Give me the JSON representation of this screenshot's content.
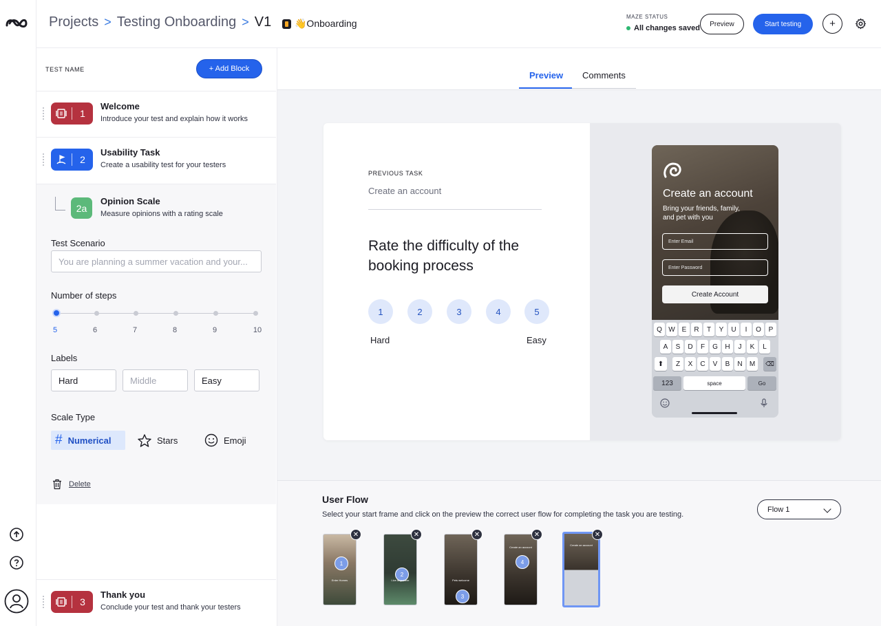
{
  "header": {
    "breadcrumbs": [
      "Projects",
      "Testing Onboarding",
      "V1"
    ],
    "separator": ">",
    "prototype_name": "👋Onboarding",
    "status_label": "MAZE STATUS",
    "status_value": "All changes saved",
    "preview_button": "Preview",
    "start_button": "Start testing",
    "add_symbol": "+"
  },
  "sidebar": {
    "test_name_label": "TEST NAME",
    "add_block_label": "+ Add Block",
    "blocks": [
      {
        "number": "1",
        "title": "Welcome",
        "description": "Introduce your test and explain how it works",
        "color": "#b5323f",
        "icon": "welcome-icon"
      },
      {
        "number": "2",
        "title": "Usability Task",
        "description": "Create a usability test for your testers",
        "color": "#2563eb",
        "icon": "flag-icon"
      },
      {
        "number": "3",
        "title": "Thank you",
        "description": "Conclude your test and thank your testers",
        "color": "#b5323f",
        "icon": "welcome-icon"
      }
    ],
    "editor": {
      "badge": "2a",
      "title": "Opinion Scale",
      "description": "Measure opinions with a rating scale",
      "scenario_label": "Test Scenario",
      "scenario_placeholder": "You are planning a summer vacation and your...",
      "steps_label": "Number of steps",
      "steps": [
        "5",
        "6",
        "7",
        "8",
        "9",
        "10"
      ],
      "steps_selected": "5",
      "labels_label": "Labels",
      "label_low": "Hard",
      "label_mid_placeholder": "Middle",
      "label_high": "Easy",
      "scale_type_label": "Scale Type",
      "scale_types": [
        "Numerical",
        "Stars",
        "Emoji"
      ],
      "scale_type_selected": "Numerical",
      "delete_label": "Delete"
    }
  },
  "tabs": {
    "preview": "Preview",
    "comments": "Comments",
    "active": "Preview"
  },
  "preview": {
    "previous_task_label": "PREVIOUS TASK",
    "previous_task": "Create an account",
    "question": "Rate the difficulty of the booking process",
    "ratings": [
      "1",
      "2",
      "3",
      "4",
      "5"
    ],
    "low_label": "Hard",
    "high_label": "Easy",
    "phone": {
      "title": "Create an account",
      "subtitle": "Bring your friends, family, and pet with you",
      "email_placeholder": "Enter Email",
      "password_placeholder": "Enter Password",
      "button": "Create Account",
      "keyboard_rows": [
        [
          "Q",
          "W",
          "E",
          "R",
          "T",
          "Y",
          "U",
          "I",
          "O",
          "P"
        ],
        [
          "A",
          "S",
          "D",
          "F",
          "G",
          "H",
          "J",
          "K",
          "L"
        ],
        [
          "Z",
          "X",
          "C",
          "V",
          "B",
          "N",
          "M"
        ]
      ],
      "key_123": "123",
      "key_space": "space",
      "key_go": "Go"
    }
  },
  "user_flow": {
    "title": "User Flow",
    "description": "Select your start frame and click on the preview the correct user flow for completing the task you are testing.",
    "flow_select": "Flow 1",
    "frames": [
      {
        "step": "1",
        "caption": "Enter Homes"
      },
      {
        "step": "2",
        "caption": "Live Anywhere"
      },
      {
        "step": "3",
        "caption": "Pets welcome"
      },
      {
        "step": "4",
        "caption": "Create an account"
      },
      {
        "step": "",
        "caption": "Create an account"
      }
    ]
  },
  "rail": {
    "icons": [
      "maze-logo-icon",
      "upload-icon",
      "help-icon",
      "user-icon"
    ]
  }
}
